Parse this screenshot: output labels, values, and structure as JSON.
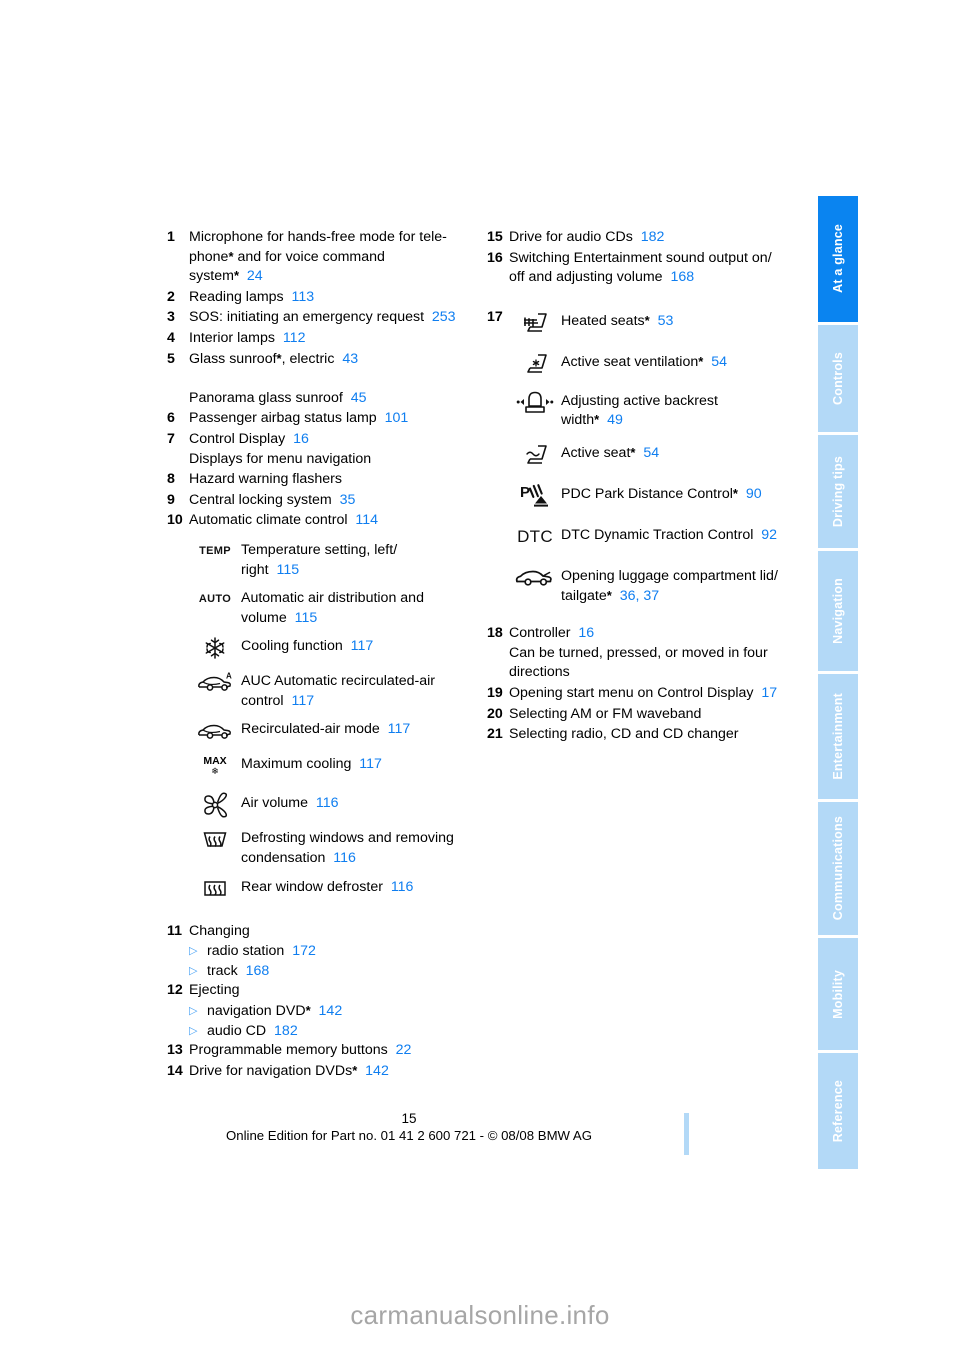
{
  "document": {
    "page_number": "15",
    "footer_line": "Online Edition for Part no. 01 41 2 600 721 - © 08/08 BMW AG",
    "watermark": "carmanualsonline.info",
    "accent_blue": "#0f7ef0",
    "tab_active_color": "#0a84f0",
    "tab_inactive_color": "#b3d9f7"
  },
  "tabs": [
    {
      "label": "At a glance",
      "active": true
    },
    {
      "label": "Controls",
      "active": false
    },
    {
      "label": "Driving tips",
      "active": false
    },
    {
      "label": "Navigation",
      "active": false
    },
    {
      "label": "Entertainment",
      "active": false
    },
    {
      "label": "Communications",
      "active": false
    },
    {
      "label": "Mobility",
      "active": false
    },
    {
      "label": "Reference",
      "active": false
    }
  ],
  "left_column": {
    "item1": {
      "num": "1",
      "line1": "Microphone for hands-free mode for tele-",
      "line2_a": "phone",
      "line2_star": "*",
      "line2_b": " and for voice command",
      "line3_a": "system",
      "line3_star": "*",
      "page": "24"
    },
    "item2": {
      "num": "2",
      "text": "Reading lamps",
      "page": "113"
    },
    "item3": {
      "num": "3",
      "text": "SOS: initiating an emergency request",
      "page": "253"
    },
    "item4": {
      "num": "4",
      "text": "Interior lamps",
      "page": "112"
    },
    "item5": {
      "num": "5",
      "text_a": "Glass sunroof",
      "star": "*",
      "text_b": ", electric",
      "page": "43",
      "sub_text": "Panorama glass sunroof",
      "sub_page": "45"
    },
    "item6": {
      "num": "6",
      "text": "Passenger airbag status lamp",
      "page": "101"
    },
    "item7": {
      "num": "7",
      "text": "Control Display",
      "page": "16",
      "sub_text": "Displays for menu navigation"
    },
    "item8": {
      "num": "8",
      "text": "Hazard warning flashers",
      "page": ""
    },
    "item9": {
      "num": "9",
      "text": "Central locking system",
      "page": "35"
    },
    "item10": {
      "num": "10",
      "text": "Automatic climate control",
      "page": "114"
    },
    "climate_icons": [
      {
        "icon": "temp-icon",
        "icon_text": "TEMP",
        "line1": "Temperature setting, left/",
        "line2": "right",
        "page": "115"
      },
      {
        "icon": "auto-icon",
        "icon_text": "AUTO",
        "line1": "Automatic air distribution and",
        "line2": "volume",
        "page": "115"
      },
      {
        "icon": "snowflake-icon",
        "icon_text": "",
        "line1": "Cooling function",
        "line2": "",
        "page": "117"
      },
      {
        "icon": "auc-recirculation-icon",
        "icon_text": "",
        "line1": "AUC Automatic recirculated-air",
        "line2": "control",
        "page": "117"
      },
      {
        "icon": "recirculation-icon",
        "icon_text": "",
        "line1": "Recirculated-air mode",
        "line2": "",
        "page": "117"
      },
      {
        "icon": "max-cooling-icon",
        "icon_text": "MAX",
        "line1": "Maximum cooling",
        "line2": "",
        "page": "117"
      },
      {
        "icon": "fan-icon",
        "icon_text": "",
        "line1": "Air volume",
        "line2": "",
        "page": "116"
      },
      {
        "icon": "windshield-defrost-icon",
        "icon_text": "",
        "line1": "Defrosting windows and removing",
        "line2": "condensation",
        "page": "116"
      },
      {
        "icon": "rear-defroster-icon",
        "icon_text": "",
        "line1": "Rear window defroster",
        "line2": "",
        "page": "116"
      }
    ],
    "item11": {
      "num": "11",
      "text": "Changing",
      "subs": [
        {
          "text": "radio station",
          "page": "172"
        },
        {
          "text": "track",
          "page": "168"
        }
      ]
    },
    "item12": {
      "num": "12",
      "text": "Ejecting",
      "subs": [
        {
          "text": "navigation DVD",
          "star": "*",
          "page": "142"
        },
        {
          "text": "audio CD",
          "star": "",
          "page": "182"
        }
      ]
    },
    "item13": {
      "num": "13",
      "text": "Programmable memory buttons",
      "page": "22"
    },
    "item14": {
      "num": "14",
      "text_a": "Drive for navigation DVDs",
      "star": "*",
      "page": "142"
    }
  },
  "right_column": {
    "item15": {
      "num": "15",
      "text": "Drive for audio CDs",
      "page": "182"
    },
    "item16": {
      "num": "16",
      "line1": "Switching Entertainment sound output on/",
      "line2": "off and adjusting volume",
      "page": "168"
    },
    "item17": {
      "num": "17"
    },
    "item17_icons": [
      {
        "icon": "heated-seat-icon",
        "icon_text": "",
        "line1": "Heated seats",
        "star": "*",
        "line2": "",
        "page": "53"
      },
      {
        "icon": "seat-ventilation-icon",
        "icon_text": "",
        "line1": "Active seat ventilation",
        "star": "*",
        "line2": "",
        "page": "54"
      },
      {
        "icon": "backrest-width-icon",
        "icon_text": "",
        "line1": "Adjusting active backrest",
        "star": "*",
        "line2": "width",
        "page": "49"
      },
      {
        "icon": "active-seat-icon",
        "icon_text": "",
        "line1": "Active seat",
        "star": "*",
        "line2": "",
        "page": "54"
      },
      {
        "icon": "pdc-icon",
        "icon_text": "",
        "line1": "PDC Park Distance Control",
        "star": "*",
        "line2": "",
        "page": "90"
      },
      {
        "icon": "dtc-icon",
        "icon_text": "DTC",
        "line1": "DTC Dynamic Traction Control",
        "star": "",
        "line2": "",
        "page": "92"
      },
      {
        "icon": "trunk-lid-icon",
        "icon_text": "",
        "line1": "Opening luggage compartment lid/",
        "star": "*",
        "line2": "tailgate",
        "page": "36, 37"
      }
    ],
    "item18": {
      "num": "18",
      "text": "Controller",
      "page": "16",
      "sub_line1": "Can be turned, pressed, or moved in four",
      "sub_line2": "directions"
    },
    "item19": {
      "num": "19",
      "text": "Opening start menu on Control Display",
      "page": "17"
    },
    "item20": {
      "num": "20",
      "text": "Selecting AM or FM waveband",
      "page": ""
    },
    "item21": {
      "num": "21",
      "text": "Selecting radio, CD and CD changer",
      "page": ""
    }
  }
}
